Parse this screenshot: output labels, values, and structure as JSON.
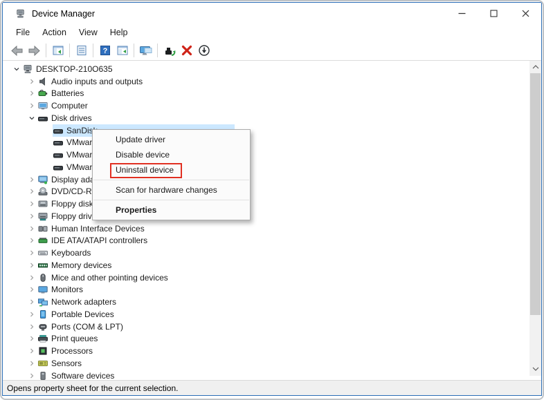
{
  "window": {
    "title": "Device Manager",
    "icon": "device-manager-icon",
    "controls": [
      {
        "name": "minimize-button",
        "icon": "minimize-icon"
      },
      {
        "name": "maximize-button",
        "icon": "maximize-icon"
      },
      {
        "name": "close-button",
        "icon": "close-icon"
      }
    ]
  },
  "menu_bar": {
    "items": [
      {
        "label": "File"
      },
      {
        "label": "Action"
      },
      {
        "label": "View"
      },
      {
        "label": "Help"
      }
    ]
  },
  "toolbar": {
    "buttons": [
      {
        "name": "back-button",
        "icon": "back-arrow-icon"
      },
      {
        "name": "forward-button",
        "icon": "forward-arrow-icon"
      },
      {
        "separator": true
      },
      {
        "name": "show-console-tree-button",
        "icon": "console-tree-icon"
      },
      {
        "separator": true
      },
      {
        "name": "properties-list-button",
        "icon": "list-icon"
      },
      {
        "separator": true
      },
      {
        "name": "help-button",
        "icon": "help-icon"
      },
      {
        "name": "action-pane-button",
        "icon": "table-pane-icon"
      },
      {
        "separator": true
      },
      {
        "name": "popup-help-button",
        "icon": "monitor-popup-icon"
      },
      {
        "separator": true
      },
      {
        "name": "update-driver-button",
        "icon": "update-driver-icon"
      },
      {
        "name": "uninstall-device-button",
        "icon": "uninstall-x-icon"
      },
      {
        "name": "scan-hardware-button",
        "icon": "scan-down-icon"
      }
    ]
  },
  "tree": {
    "rows": [
      {
        "label": "DESKTOP-210O635",
        "level": 0,
        "chevron": "expanded",
        "icon": "computer-root-icon"
      },
      {
        "label": "Audio inputs and outputs",
        "level": 1,
        "chevron": "collapsed",
        "icon": "audio-icon"
      },
      {
        "label": "Batteries",
        "level": 1,
        "chevron": "collapsed",
        "icon": "battery-icon"
      },
      {
        "label": "Computer",
        "level": 1,
        "chevron": "collapsed",
        "icon": "computer-icon"
      },
      {
        "label": "Disk drives",
        "level": 1,
        "chevron": "expanded",
        "icon": "disk-icon"
      },
      {
        "label": "SanDisk",
        "level": 2,
        "chevron": "none",
        "icon": "disk-icon",
        "selected": true
      },
      {
        "label": "VMware",
        "level": 2,
        "chevron": "none",
        "icon": "disk-icon"
      },
      {
        "label": "VMware",
        "level": 2,
        "chevron": "none",
        "icon": "disk-icon"
      },
      {
        "label": "VMware",
        "level": 2,
        "chevron": "none",
        "icon": "disk-icon"
      },
      {
        "label": "Display ada",
        "level": 1,
        "chevron": "collapsed",
        "icon": "display-adapter-icon"
      },
      {
        "label": "DVD/CD-R",
        "level": 1,
        "chevron": "collapsed",
        "icon": "dvd-icon"
      },
      {
        "label": "Floppy disk",
        "level": 1,
        "chevron": "collapsed",
        "icon": "floppy-drive-icon"
      },
      {
        "label": "Floppy drive controllers",
        "level": 1,
        "chevron": "collapsed",
        "icon": "floppy-controller-icon"
      },
      {
        "label": "Human Interface Devices",
        "level": 1,
        "chevron": "collapsed",
        "icon": "hid-icon"
      },
      {
        "label": "IDE ATA/ATAPI controllers",
        "level": 1,
        "chevron": "collapsed",
        "icon": "ide-icon"
      },
      {
        "label": "Keyboards",
        "level": 1,
        "chevron": "collapsed",
        "icon": "keyboard-icon"
      },
      {
        "label": "Memory devices",
        "level": 1,
        "chevron": "collapsed",
        "icon": "memory-icon"
      },
      {
        "label": "Mice and other pointing devices",
        "level": 1,
        "chevron": "collapsed",
        "icon": "mouse-icon"
      },
      {
        "label": "Monitors",
        "level": 1,
        "chevron": "collapsed",
        "icon": "monitor-icon"
      },
      {
        "label": "Network adapters",
        "level": 1,
        "chevron": "collapsed",
        "icon": "network-icon"
      },
      {
        "label": "Portable Devices",
        "level": 1,
        "chevron": "collapsed",
        "icon": "portable-device-icon"
      },
      {
        "label": "Ports (COM & LPT)",
        "level": 1,
        "chevron": "collapsed",
        "icon": "ports-icon"
      },
      {
        "label": "Print queues",
        "level": 1,
        "chevron": "collapsed",
        "icon": "printer-icon"
      },
      {
        "label": "Processors",
        "level": 1,
        "chevron": "collapsed",
        "icon": "processor-icon"
      },
      {
        "label": "Sensors",
        "level": 1,
        "chevron": "collapsed",
        "icon": "sensor-icon"
      },
      {
        "label": "Software devices",
        "level": 1,
        "chevron": "collapsed",
        "icon": "software-device-icon"
      }
    ]
  },
  "context_menu": {
    "items": [
      {
        "label": "Update driver"
      },
      {
        "label": "Disable device"
      },
      {
        "label": "Uninstall device",
        "highlighted": true
      },
      {
        "separator": true
      },
      {
        "label": "Scan for hardware changes"
      },
      {
        "separator": true
      },
      {
        "label": "Properties",
        "bold": true
      }
    ]
  },
  "status_bar": {
    "text": "Opens property sheet for the current selection."
  },
  "colors": {
    "window_border": "#2a6cb5",
    "selection_highlight": "#cce8ff",
    "uninstall_box": "#e12f21",
    "menu_border": "#ababab"
  }
}
